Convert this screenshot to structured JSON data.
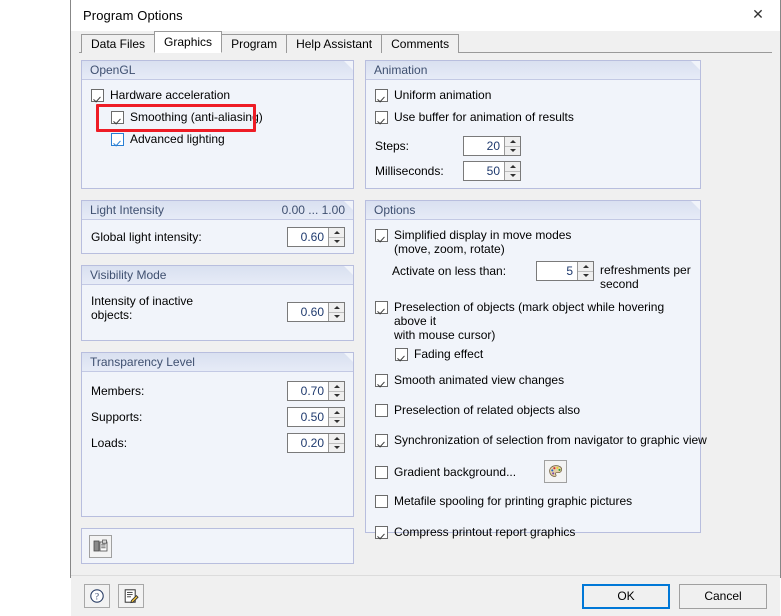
{
  "window": {
    "title": "Program Options",
    "close_icon": "close-icon"
  },
  "tabs": [
    {
      "label": "Data Files",
      "active": false
    },
    {
      "label": "Graphics",
      "active": true
    },
    {
      "label": "Program",
      "active": false
    },
    {
      "label": "Help Assistant",
      "active": false
    },
    {
      "label": "Comments",
      "active": false
    }
  ],
  "left": {
    "opengl": {
      "title": "OpenGL",
      "hardware_acceleration": "Hardware acceleration",
      "smoothing": "Smoothing (anti-aliasing)",
      "advanced_lighting": "Advanced lighting"
    },
    "light_intensity": {
      "title": "Light Intensity",
      "range": "0.00 ... 1.00",
      "global_label": "Global light intensity:",
      "global_value": "0.60"
    },
    "visibility_mode": {
      "title": "Visibility Mode",
      "inactive_label_line1": "Intensity of inactive",
      "inactive_label_line2": "objects:",
      "inactive_value": "0.60"
    },
    "transparency": {
      "title": "Transparency Level",
      "members_label": "Members:",
      "members_value": "0.70",
      "supports_label": "Supports:",
      "supports_value": "0.50",
      "loads_label": "Loads:",
      "loads_value": "0.20"
    },
    "bottom_tool_icon": "render-settings-icon"
  },
  "right": {
    "animation": {
      "title": "Animation",
      "uniform_animation": "Uniform animation",
      "use_buffer": "Use buffer for animation of results",
      "steps_label": "Steps:",
      "steps_value": "20",
      "ms_label": "Milliseconds:",
      "ms_value": "50"
    },
    "options": {
      "title": "Options",
      "simplified_line1": "Simplified display in move modes",
      "simplified_line2": "(move, zoom, rotate)",
      "activate_label": "Activate on less than:",
      "activate_value": "5",
      "activate_suffix_line1": "refreshments per",
      "activate_suffix_line2": "second",
      "preselection_line1": "Preselection of objects (mark object while hovering above it",
      "preselection_line2": "with mouse cursor)",
      "fading_effect": "Fading effect",
      "smooth_animated": "Smooth animated view changes",
      "preselection_related": "Preselection of related objects also",
      "synchronization": "Synchronization of selection from navigator to graphic view",
      "gradient_background": "Gradient background...",
      "gradient_icon": "color-palette-icon",
      "metafile_spooling": "Metafile spooling for printing graphic pictures",
      "compress_printout": "Compress printout report graphics"
    }
  },
  "footer": {
    "help_icon": "help-question-icon",
    "notes_icon": "edit-notes-icon",
    "ok_label": "OK",
    "cancel_label": "Cancel"
  },
  "colors": {
    "highlight": "#ee1c25",
    "accent": "#0078d7",
    "group_header_text": "#3f5070",
    "spin_value_text": "#1f3a6e"
  }
}
